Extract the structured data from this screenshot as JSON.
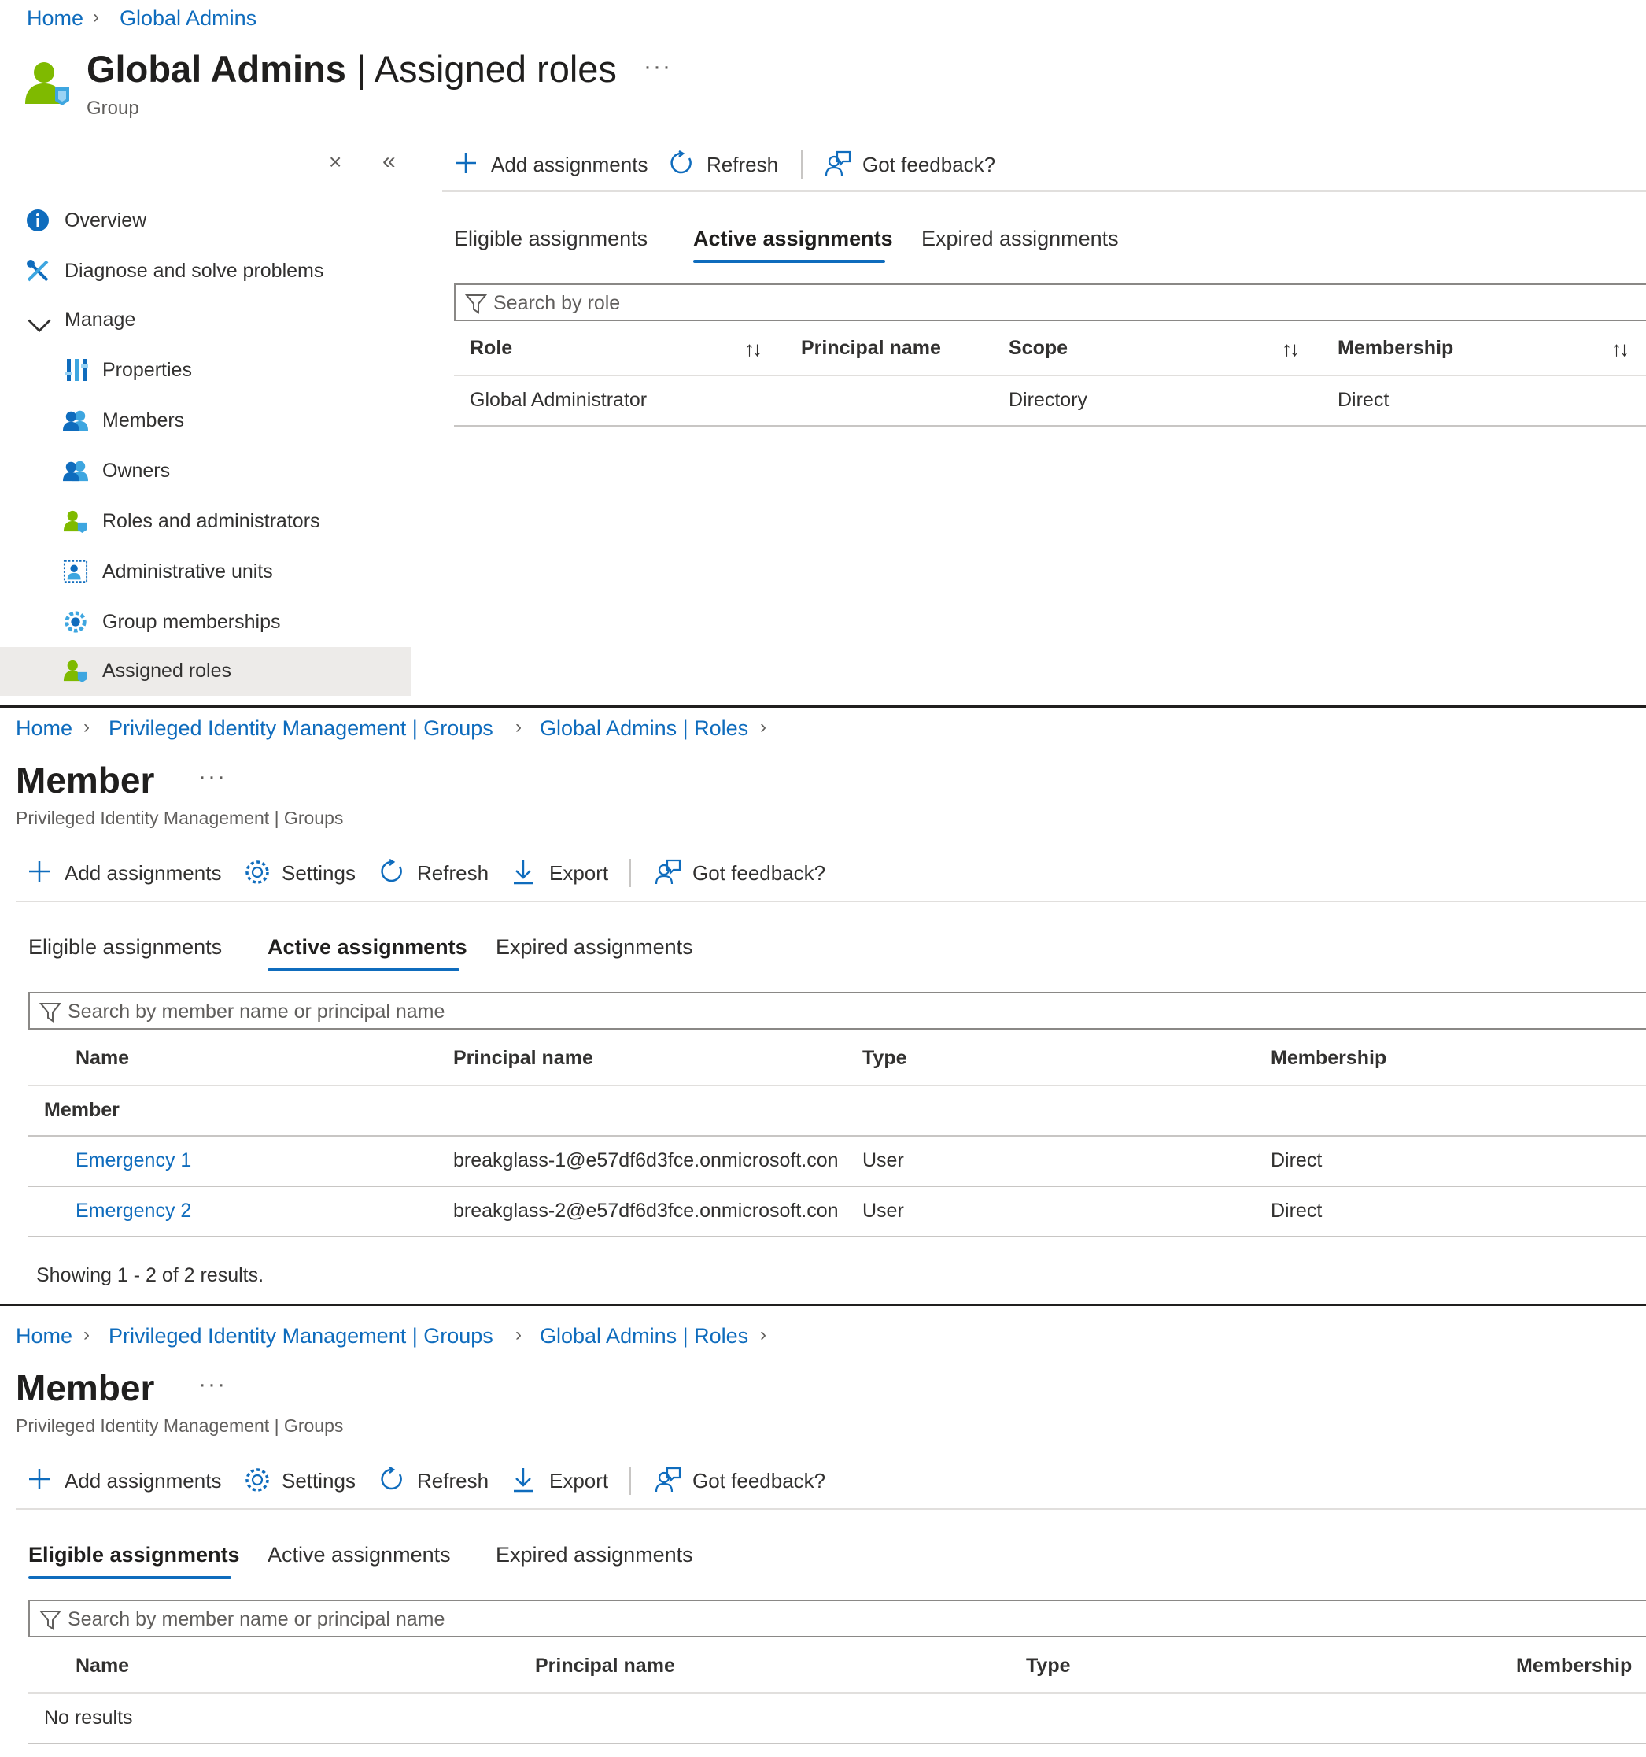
{
  "panel1": {
    "breadcrumb": [
      "Home",
      "Global Admins"
    ],
    "title_bold": "Global Admins",
    "title_rest": "| Assigned roles",
    "subtitle": "Group",
    "ellipsis": "···",
    "sidebar_controls": {
      "close": "×",
      "collapse": "«"
    },
    "nav": {
      "overview": "Overview",
      "diagnose": "Diagnose and solve problems",
      "manage": "Manage",
      "properties": "Properties",
      "members": "Members",
      "owners": "Owners",
      "roles_admins": "Roles and administrators",
      "admin_units": "Administrative units",
      "group_memberships": "Group memberships",
      "assigned_roles": "Assigned roles"
    },
    "toolbar": {
      "add": "Add assignments",
      "refresh": "Refresh",
      "feedback": "Got feedback?"
    },
    "tabs": [
      "Eligible assignments",
      "Active assignments",
      "Expired assignments"
    ],
    "active_tab": 1,
    "search_placeholder": "Search by role",
    "columns": [
      "Role",
      "Principal name",
      "Scope",
      "Membership"
    ],
    "sort_glyph": "↑↓",
    "rows": [
      {
        "role": "Global Administrator",
        "principal": "",
        "scope": "Directory",
        "membership": "Direct"
      }
    ]
  },
  "panel2": {
    "breadcrumb": [
      "Home",
      "Privileged Identity Management | Groups",
      "Global Admins | Roles"
    ],
    "title": "Member",
    "ellipsis": "···",
    "subtitle": "Privileged Identity Management | Groups",
    "toolbar": {
      "add": "Add assignments",
      "settings": "Settings",
      "refresh": "Refresh",
      "export": "Export",
      "feedback": "Got feedback?"
    },
    "tabs": [
      "Eligible assignments",
      "Active assignments",
      "Expired assignments"
    ],
    "active_tab": 1,
    "search_placeholder": "Search by member name or principal name",
    "columns": [
      "Name",
      "Principal name",
      "Type",
      "Membership"
    ],
    "group_label": "Member",
    "rows": [
      {
        "name": "Emergency 1",
        "principal": "breakglass-1@e57df6d3fce.onmicrosoft.con",
        "type": "User",
        "membership": "Direct"
      },
      {
        "name": "Emergency 2",
        "principal": "breakglass-2@e57df6d3fce.onmicrosoft.con",
        "type": "User",
        "membership": "Direct"
      }
    ],
    "results_text": "Showing 1 - 2 of 2 results."
  },
  "panel3": {
    "breadcrumb": [
      "Home",
      "Privileged Identity Management | Groups",
      "Global Admins | Roles"
    ],
    "title": "Member",
    "ellipsis": "···",
    "subtitle": "Privileged Identity Management | Groups",
    "toolbar": {
      "add": "Add assignments",
      "settings": "Settings",
      "refresh": "Refresh",
      "export": "Export",
      "feedback": "Got feedback?"
    },
    "tabs": [
      "Eligible assignments",
      "Active assignments",
      "Expired assignments"
    ],
    "active_tab": 0,
    "search_placeholder": "Search by member name or principal name",
    "columns": [
      "Name",
      "Principal name",
      "Type",
      "Membership"
    ],
    "empty_text": "No results"
  },
  "colors": {
    "accent": "#0f6cbd",
    "selected_nav": "#edebe9",
    "text": "#323130"
  }
}
